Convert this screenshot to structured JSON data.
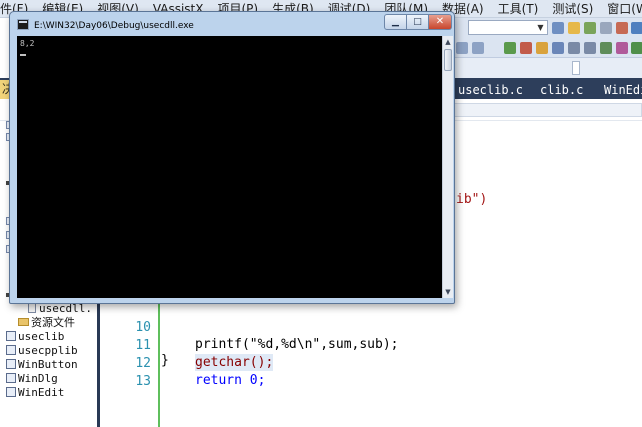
{
  "menubar": {
    "items": [
      "件(F)",
      "编辑(E)",
      "视图(V)",
      "VAssistX",
      "项目(P)",
      "生成(B)",
      "调试(D)",
      "团队(M)",
      "数据(A)",
      "工具(T)",
      "测试(S)",
      "窗口(W)"
    ]
  },
  "tabs": {
    "left_tab": "决",
    "documents": [
      "useclib.c",
      "clib.c",
      "WinEdi"
    ]
  },
  "solution_explorer": {
    "items": [
      {
        "label": "usecdll.",
        "kind": "file"
      },
      {
        "label": "资源文件",
        "kind": "folder"
      },
      {
        "label": "useclib",
        "kind": "project"
      },
      {
        "label": "usecpplib",
        "kind": "project"
      },
      {
        "label": "WinButton",
        "kind": "project"
      },
      {
        "label": "WinDlg",
        "kind": "project"
      },
      {
        "label": "WinEdit",
        "kind": "project"
      }
    ]
  },
  "editor": {
    "fragment": "ib\")",
    "lines": [
      {
        "number": "10",
        "code": "printf(\"%d,%d\\n\",sum,sub);"
      },
      {
        "number": "11",
        "code": "getchar();"
      },
      {
        "number": "12",
        "code": "return 0;"
      },
      {
        "number": "13",
        "code": "}"
      }
    ]
  },
  "console": {
    "title": "E:\\WIN32\\Day06\\Debug\\usecdll.exe",
    "output": "8,2",
    "buttons": {
      "minimize": "▁",
      "maximize": "□",
      "close": "✕"
    }
  },
  "colors": {
    "tab_bar": "#2d3e5b",
    "menubar": "#dfe7f2",
    "console_frame": "#bcd3ec",
    "close_button": "#c8452c",
    "gutter_change": "#5fbf5c"
  }
}
